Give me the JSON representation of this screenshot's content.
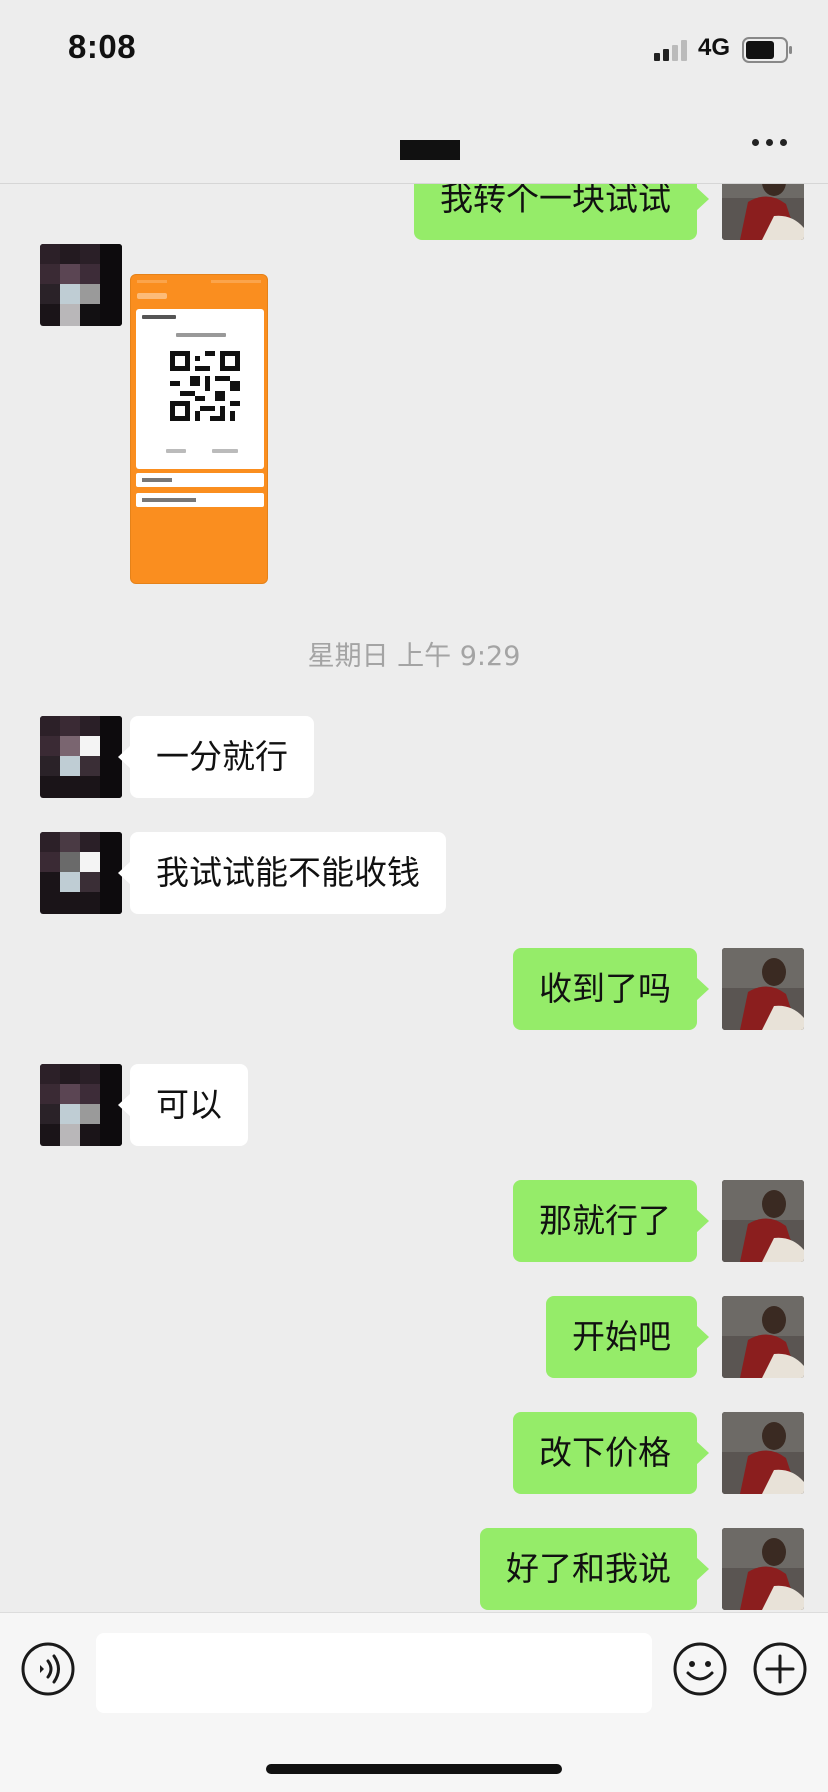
{
  "status_bar": {
    "time": "8:08",
    "network": "4G",
    "signal_icon": "cellular-signal-icon",
    "battery_icon": "battery-icon"
  },
  "nav": {
    "title": "",
    "more_icon": "more-dots-icon"
  },
  "messages": [
    {
      "side": "self",
      "type": "text",
      "text": "我转个一块试试"
    },
    {
      "side": "other",
      "type": "image",
      "description": "payment-qr-screenshot"
    },
    {
      "type": "time",
      "text": "星期日 上午 9:29"
    },
    {
      "side": "other",
      "type": "text",
      "text": "一分就行"
    },
    {
      "side": "other",
      "type": "text",
      "text": "我试试能不能收钱"
    },
    {
      "side": "self",
      "type": "text",
      "text": "收到了吗"
    },
    {
      "side": "other",
      "type": "text",
      "text": "可以"
    },
    {
      "side": "self",
      "type": "text",
      "text": "那就行了"
    },
    {
      "side": "self",
      "type": "text",
      "text": "开始吧"
    },
    {
      "side": "self",
      "type": "text",
      "text": "改下价格"
    },
    {
      "side": "self",
      "type": "text",
      "text": "好了和我说"
    }
  ],
  "input_bar": {
    "value": "",
    "placeholder": "",
    "voice_icon": "voice-icon",
    "emoji_icon": "emoji-icon",
    "plus_icon": "plus-icon"
  },
  "colors": {
    "background": "#ededed",
    "self_bubble": "#95ec69",
    "other_bubble": "#ffffff",
    "timestamp_text": "#a4a4a4",
    "image_orange": "#fa8e1f"
  }
}
